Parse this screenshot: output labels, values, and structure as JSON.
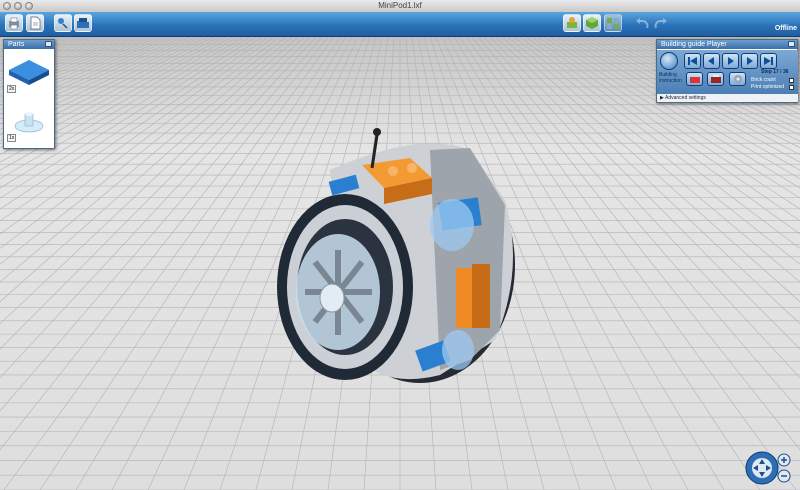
{
  "window": {
    "title": "MiniPod1.lxf",
    "status": "Offline"
  },
  "toolbar": {
    "left_icons": [
      "print-icon",
      "new-file-icon",
      "share-icon",
      "open-file-icon"
    ],
    "right_icons": [
      "build-mode-icon",
      "view-mode-icon",
      "guide-mode-icon",
      "undo-icon",
      "redo-icon"
    ]
  },
  "parts_panel": {
    "title": "Parts",
    "items": [
      {
        "name": "blue plate",
        "count": "2x",
        "color": "#2a7fd0"
      },
      {
        "name": "transparent clear part",
        "count": "1x",
        "color": "#bcdff3"
      }
    ]
  },
  "guide_panel": {
    "title": "Building guide Player",
    "step_label": "Step 17 / 36",
    "building_instruction_label": "Building instruction",
    "brick_count_label": "Brick count",
    "print_optimized_label": "Print optimized",
    "advanced_settings_label": "Advanced settings"
  },
  "colors": {
    "accent": "#2a73b9",
    "part_orange": "#f08a24",
    "part_blue": "#2a7fd0"
  }
}
